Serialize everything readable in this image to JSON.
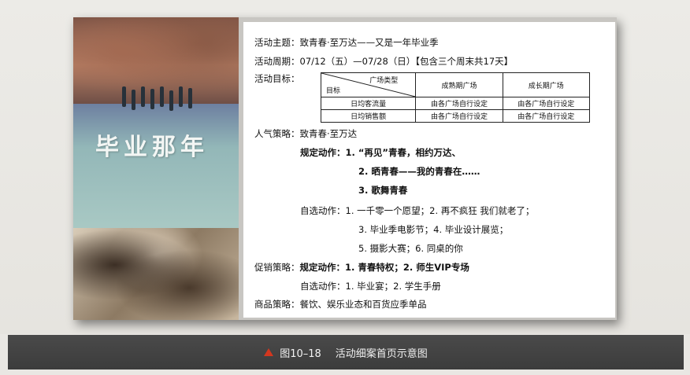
{
  "content": {
    "theme_label": "活动主题：",
    "theme_value": "致青春·至万达——又是一年毕业季",
    "period_label": "活动周期：",
    "period_value": "07/12（五）—07/28（日）【包含三个周末共17天】",
    "goal_label": "活动目标：",
    "goal_table": {
      "corner_top": "广场类型",
      "corner_bottom": "目标",
      "columns": [
        "成熟期广场",
        "成长期广场"
      ],
      "rows": [
        {
          "label": "日均客流量",
          "cells": [
            "由各广场自行设定",
            "由各广场自行设定"
          ]
        },
        {
          "label": "日均销售额",
          "cells": [
            "由各广场自行设定",
            "由各广场自行设定"
          ]
        }
      ]
    },
    "popularity_label": "人气策略：",
    "popularity_value": "致青春·至万达",
    "required_label": "规定动作：",
    "required_1": "1. “再见”青春，相约万达、",
    "required_2": "2. 晒青春——我的青春在……",
    "required_3": "3.   歌舞青春",
    "optional_label": "自选动作：",
    "optional_1": "1. 一千零一个愿望；2. 再不疯狂  我们就老了；",
    "optional_2": "3. 毕业季电影节；4. 毕业设计展览；",
    "optional_3": "5. 摄影大赛；6. 同桌的你",
    "promo_label": "促销策略：",
    "promo_required_label": "规定动作：",
    "promo_required_value": "1. 青春特权；2. 师生VIP专场",
    "promo_optional_label": "自选动作：",
    "promo_optional_value": "1.   毕业宴；2. 学生手册",
    "goods_label": "商品策略：",
    "goods_value": "餐饮、娱乐业态和百货应季单品"
  },
  "poster": {
    "title": "毕业那年"
  },
  "caption": {
    "icon": "triangle-marker-icon",
    "number": "图10–18",
    "text": "活动细案首页示意图"
  },
  "colors": {
    "caption_bar": "#3f3f3f",
    "caption_icon": "#d2371f",
    "content_bg": "#ffffff"
  }
}
